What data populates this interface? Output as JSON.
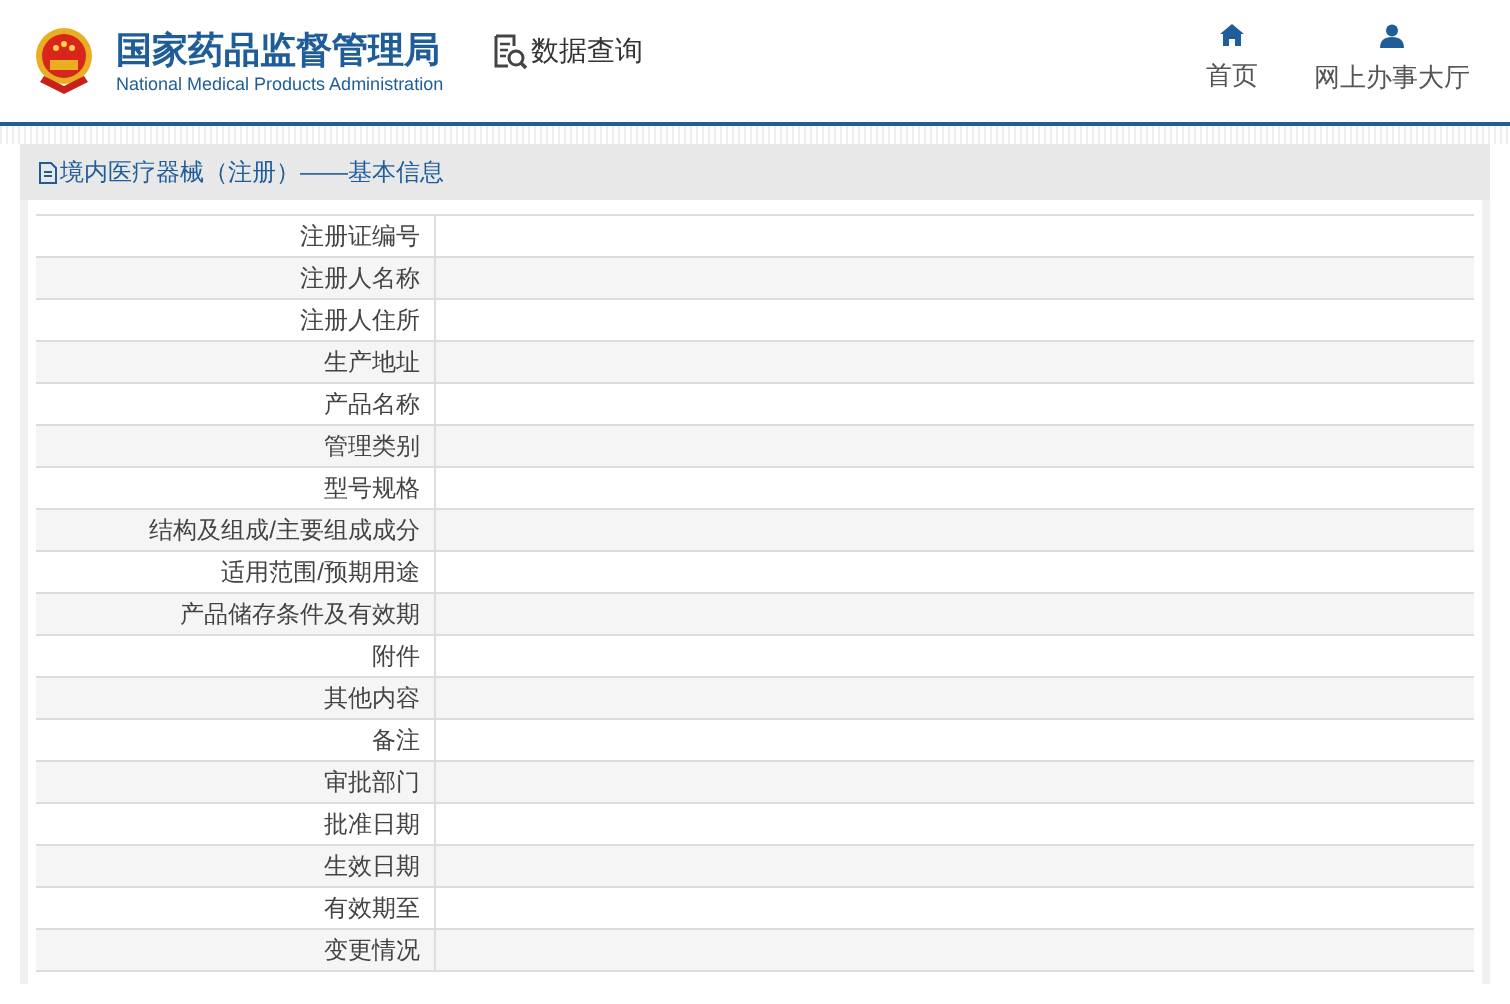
{
  "header": {
    "org_name": "国家药品监督管理局",
    "org_name_en": "National Medical Products Administration",
    "query_link": "数据查询",
    "nav": [
      {
        "kind": "home",
        "label": "首页"
      },
      {
        "kind": "user",
        "label": "网上办事大厅"
      }
    ]
  },
  "panel": {
    "title": "境内医疗器械（注册）——基本信息",
    "rows": [
      {
        "label": "注册证编号"
      },
      {
        "label": "注册人名称"
      },
      {
        "label": "注册人住所"
      },
      {
        "label": "生产地址"
      },
      {
        "label": "产品名称"
      },
      {
        "label": "管理类别"
      },
      {
        "label": "型号规格"
      },
      {
        "label": "结构及组成/主要组成成分"
      },
      {
        "label": "适用范围/预期用途"
      },
      {
        "label": "产品储存条件及有效期"
      },
      {
        "label": "附件"
      },
      {
        "label": "其他内容"
      },
      {
        "label": "备注"
      },
      {
        "label": "审批部门"
      },
      {
        "label": "批准日期"
      },
      {
        "label": "生效日期"
      },
      {
        "label": "有效期至"
      },
      {
        "label": "变更情况"
      }
    ]
  }
}
